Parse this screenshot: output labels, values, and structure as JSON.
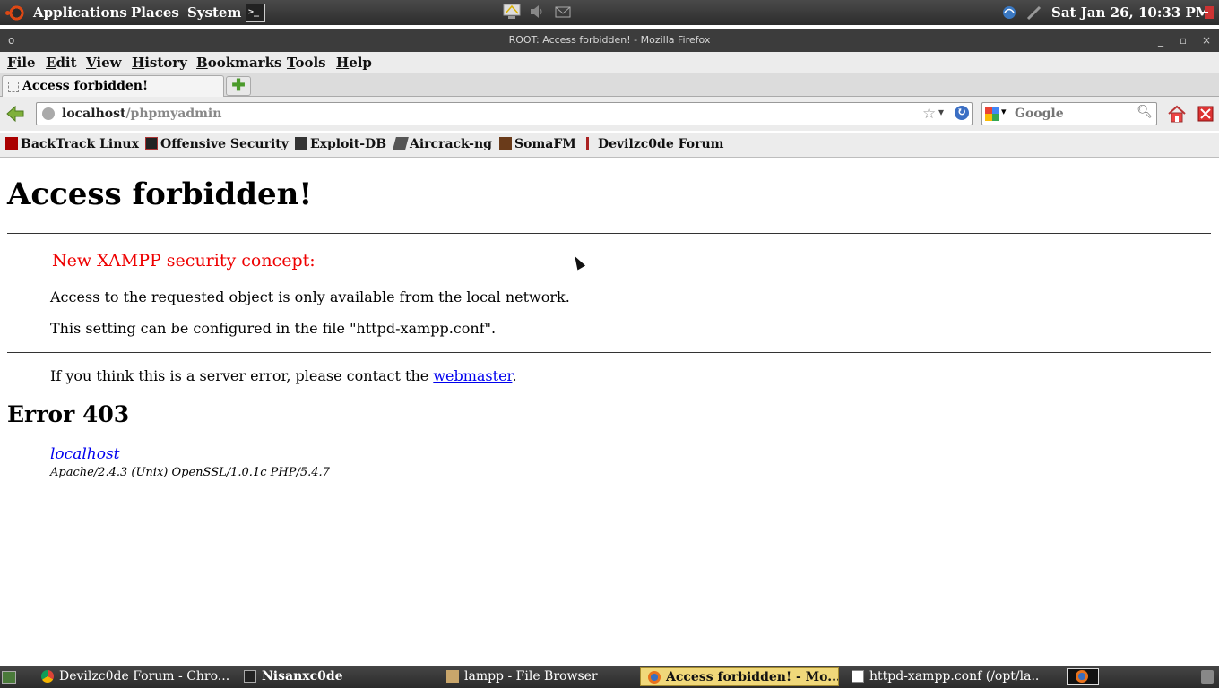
{
  "top_panel": {
    "applications": "Applications",
    "places": "Places",
    "system": "System",
    "clock": "Sat Jan 26, 10:33 PM"
  },
  "window": {
    "title": "ROOT: Access forbidden! - Mozilla Firefox"
  },
  "menubar": [
    "File",
    "Edit",
    "View",
    "History",
    "Bookmarks",
    "Tools",
    "Help"
  ],
  "tabs": [
    {
      "label": "Access forbidden!",
      "active": true
    }
  ],
  "navbar": {
    "url_host": "localhost",
    "url_path": "/phpmyadmin",
    "search_placeholder": "Google"
  },
  "bookmarks": [
    {
      "label": "BackTrack Linux",
      "icon": "backtrack-icon"
    },
    {
      "label": "Offensive Security",
      "icon": "offsec-icon"
    },
    {
      "label": "Exploit-DB",
      "icon": "exploitdb-icon"
    },
    {
      "label": "Aircrack-ng",
      "icon": "aircrack-icon"
    },
    {
      "label": "SomaFM",
      "icon": "somafm-icon"
    },
    {
      "label": "Devilzc0de Forum",
      "icon": "devilzc0de-icon"
    }
  ],
  "page": {
    "title": "Access forbidden!",
    "concept": "New XAMPP security concept:",
    "p1": "Access to the requested object is only available from the local network.",
    "p2": "This setting can be configured in the file \"httpd-xampp.conf\".",
    "p3_before": "If you think this is a server error, please contact the ",
    "p3_link": "webmaster",
    "p3_after": ".",
    "error_title": "Error 403",
    "host_link": "localhost",
    "server_signature": "Apache/2.4.3 (Unix) OpenSSL/1.0.1c PHP/5.4.7"
  },
  "taskbar": [
    {
      "label": "Devilzc0de Forum - Chro...",
      "icon": "chrome-icon",
      "active": false
    },
    {
      "label": "Nisanxc0de",
      "icon": "terminal-icon",
      "active": false
    },
    {
      "label": "lampp - File Browser",
      "icon": "folder-icon",
      "active": false
    },
    {
      "label": "Access forbidden! - Mo...",
      "icon": "firefox-icon",
      "active": true
    },
    {
      "label": "httpd-xampp.conf (/opt/la...",
      "icon": "text-editor-icon",
      "active": false
    }
  ],
  "colors": {
    "concept_red": "#e00000",
    "link_blue": "#0000ee",
    "active_task": "#f0d87a"
  }
}
